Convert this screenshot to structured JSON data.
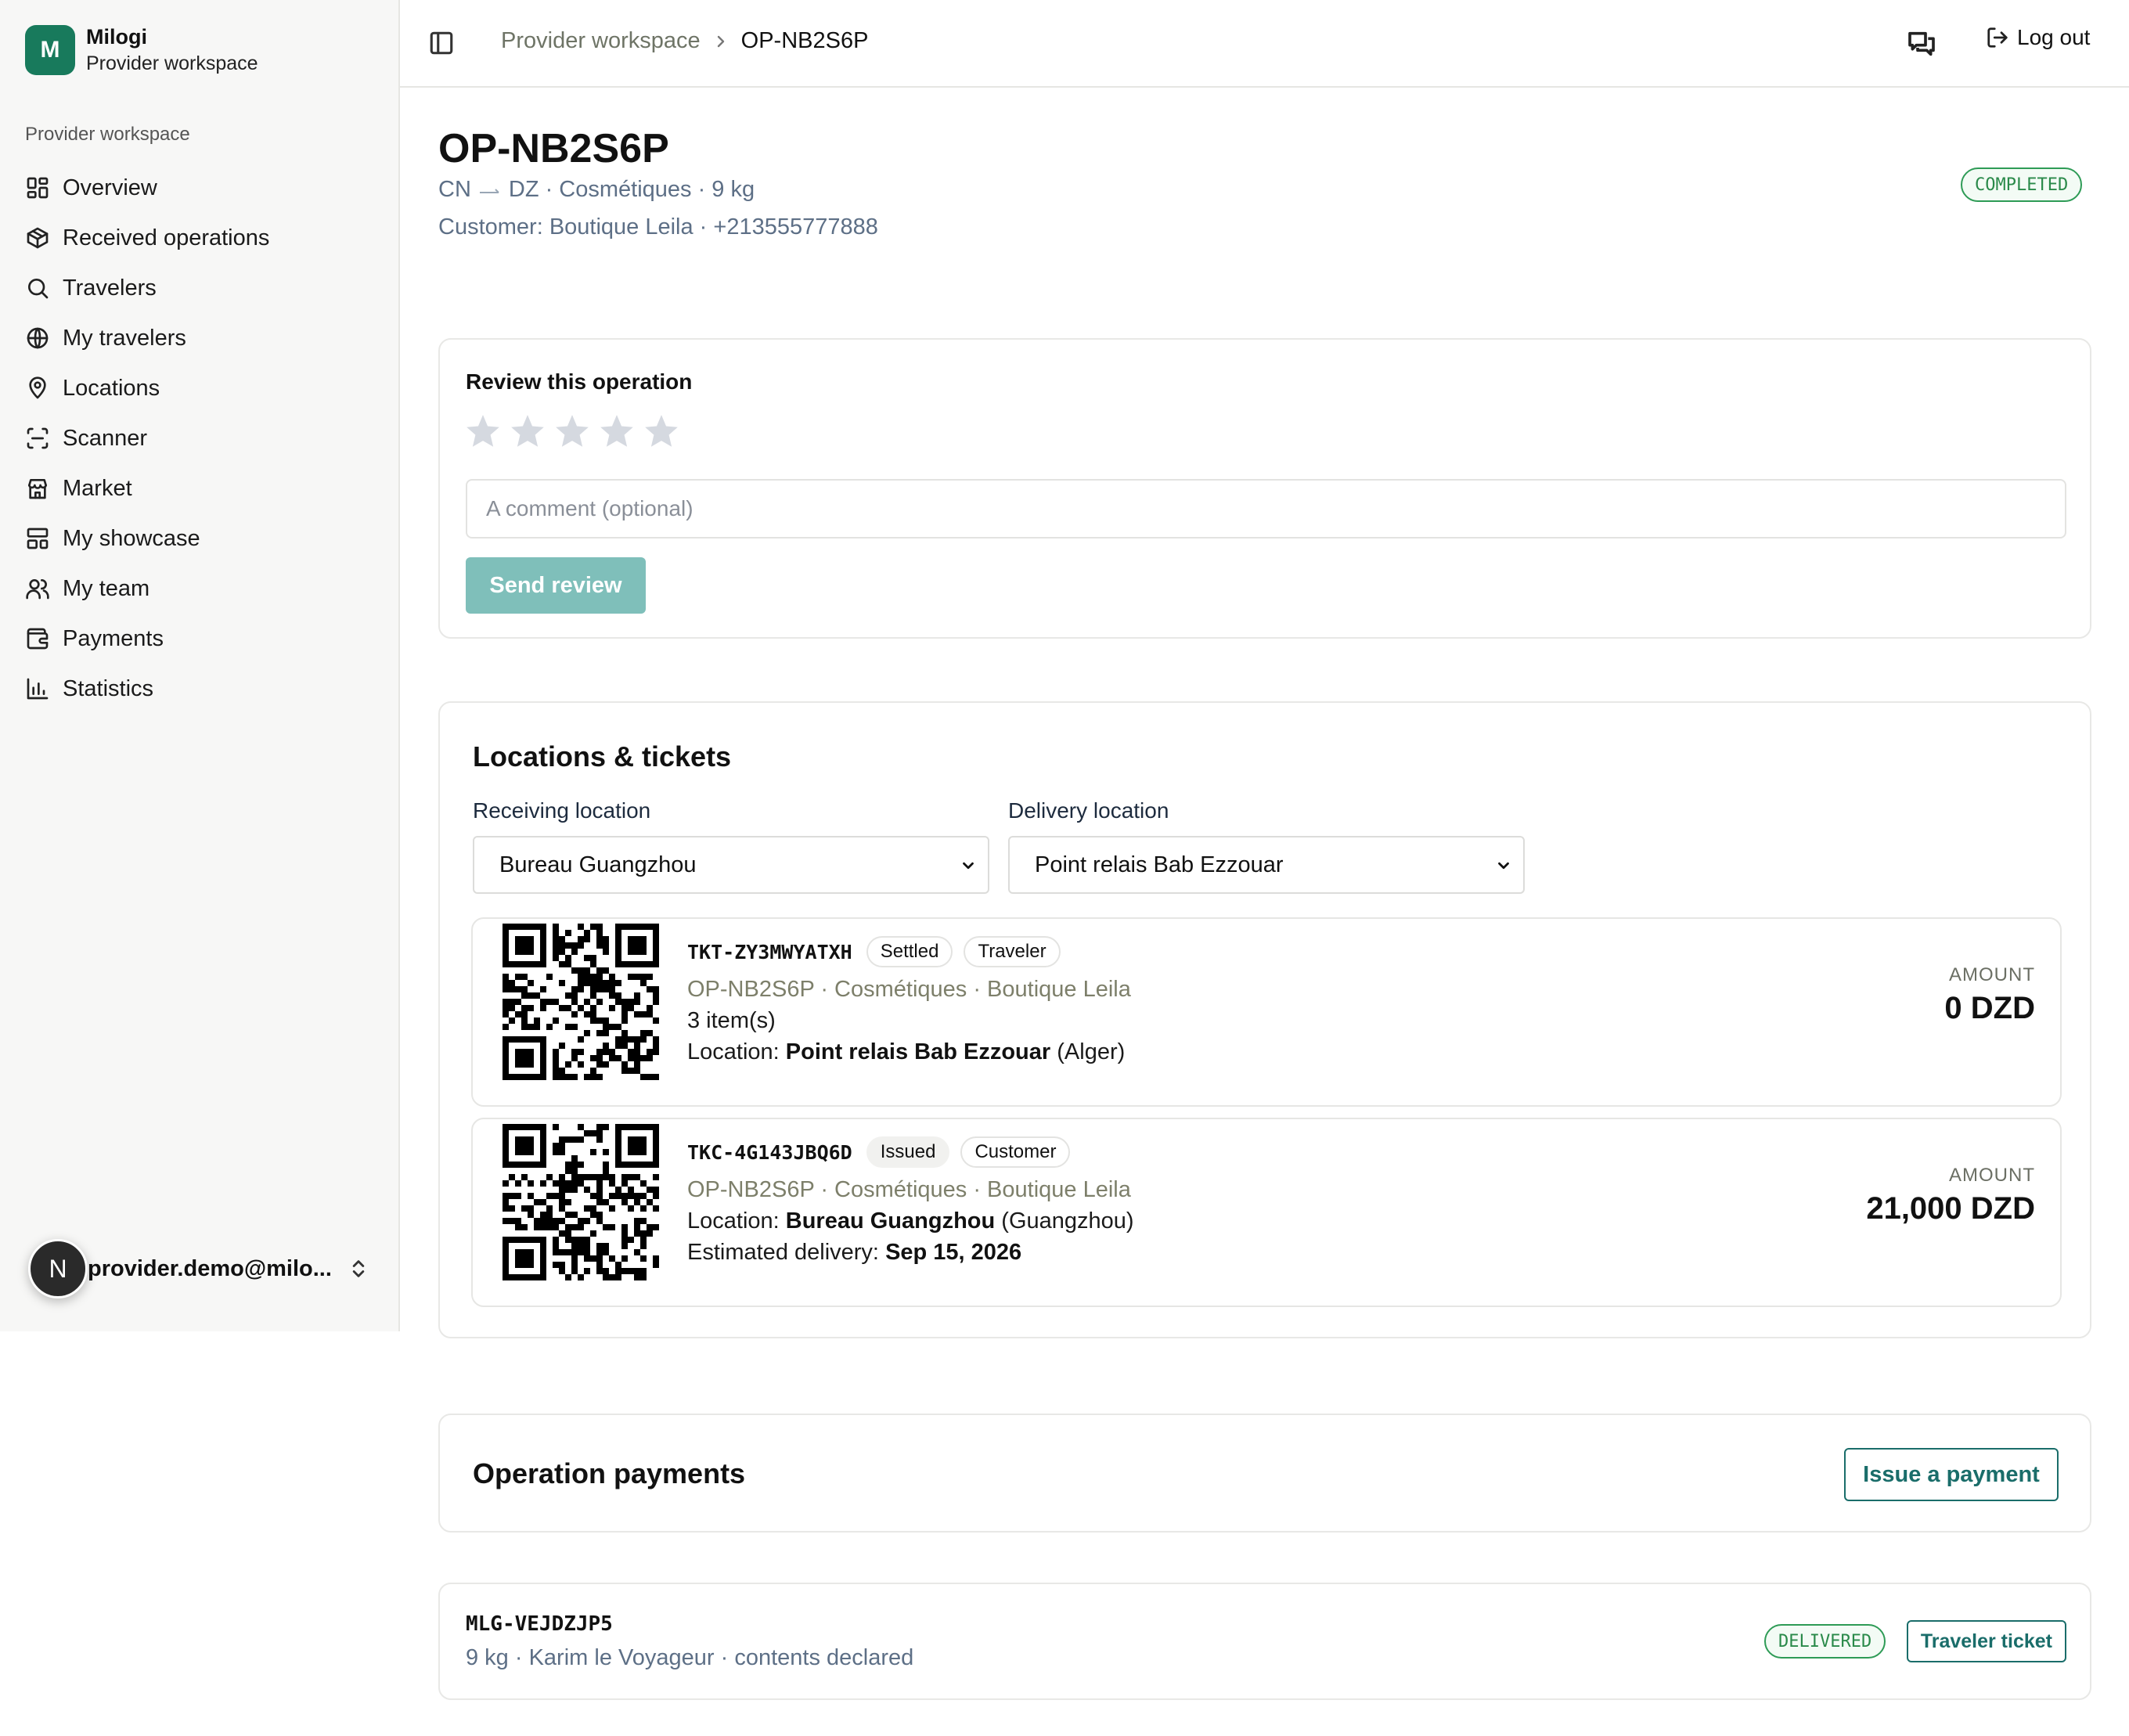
{
  "brand": {
    "logo_letter": "M",
    "name": "Milogi",
    "subtitle": "Provider workspace"
  },
  "sidebar": {
    "section_label": "Provider workspace",
    "items": [
      {
        "label": "Overview",
        "icon": "layout-grid-icon"
      },
      {
        "label": "Received operations",
        "icon": "package-icon"
      },
      {
        "label": "Travelers",
        "icon": "search-icon"
      },
      {
        "label": "My travelers",
        "icon": "globe-icon"
      },
      {
        "label": "Locations",
        "icon": "map-pin-icon"
      },
      {
        "label": "Scanner",
        "icon": "scan-icon"
      },
      {
        "label": "Market",
        "icon": "store-icon"
      },
      {
        "label": "My showcase",
        "icon": "layout-icon"
      },
      {
        "label": "My team",
        "icon": "users-icon"
      },
      {
        "label": "Payments",
        "icon": "wallet-icon"
      },
      {
        "label": "Statistics",
        "icon": "bar-chart-icon"
      }
    ],
    "user": {
      "avatar_letter": "N",
      "email": "provider.demo@milo..."
    }
  },
  "topbar": {
    "breadcrumb": {
      "parent": "Provider workspace",
      "current": "OP-NB2S6P"
    },
    "logout_label": "Log out"
  },
  "operation": {
    "code": "OP-NB2S6P",
    "origin": "CN",
    "destination": "DZ",
    "route_rest": "· Cosmétiques · 9 kg",
    "customer_line": "Customer: Boutique Leila · +213555777888",
    "status": "COMPLETED"
  },
  "review": {
    "title": "Review this operation",
    "rating": 0,
    "max_rating": 5,
    "comment_placeholder": "A comment (optional)",
    "comment_value": "",
    "submit_label": "Send review"
  },
  "locations": {
    "title": "Locations & tickets",
    "receiving_label": "Receiving location",
    "receiving_value": "Bureau Guangzhou",
    "delivery_label": "Delivery location",
    "delivery_value": "Point relais Bab Ezzouar",
    "tickets": [
      {
        "code": "TKT-ZY3MWYATXH",
        "status": "Settled",
        "role": "Traveler",
        "summary": "OP-NB2S6P · Cosmétiques · Boutique Leila",
        "items": "3 item(s)",
        "location_prefix": "Location:",
        "location_name": "Point relais Bab Ezzouar",
        "location_city": "(Alger)",
        "amount_label": "AMOUNT",
        "amount": "0 DZD"
      },
      {
        "code": "TKC-4G143JBQ6D",
        "status": "Issued",
        "role": "Customer",
        "summary": "OP-NB2S6P · Cosmétiques · Boutique Leila",
        "location_prefix": "Location:",
        "location_name": "Bureau Guangzhou",
        "location_city": "(Guangzhou)",
        "delivery_prefix": "Estimated delivery:",
        "delivery_date": "Sep 15, 2026",
        "amount_label": "AMOUNT",
        "amount": "21,000 DZD"
      }
    ]
  },
  "payments": {
    "title": "Operation payments",
    "issue_label": "Issue a payment"
  },
  "parcel": {
    "code": "MLG-VEJDZJP5",
    "meta": "9 kg · Karim le Voyageur · contents declared",
    "status": "DELIVERED",
    "ticket_button": "Traveler ticket"
  },
  "colors": {
    "brand": "#187a5c",
    "accent_teal": "#1a6d6a",
    "send_button_disabled": "#7fbfba",
    "status_green": "#2e9b56",
    "muted_blue_text": "#5d6f86"
  }
}
